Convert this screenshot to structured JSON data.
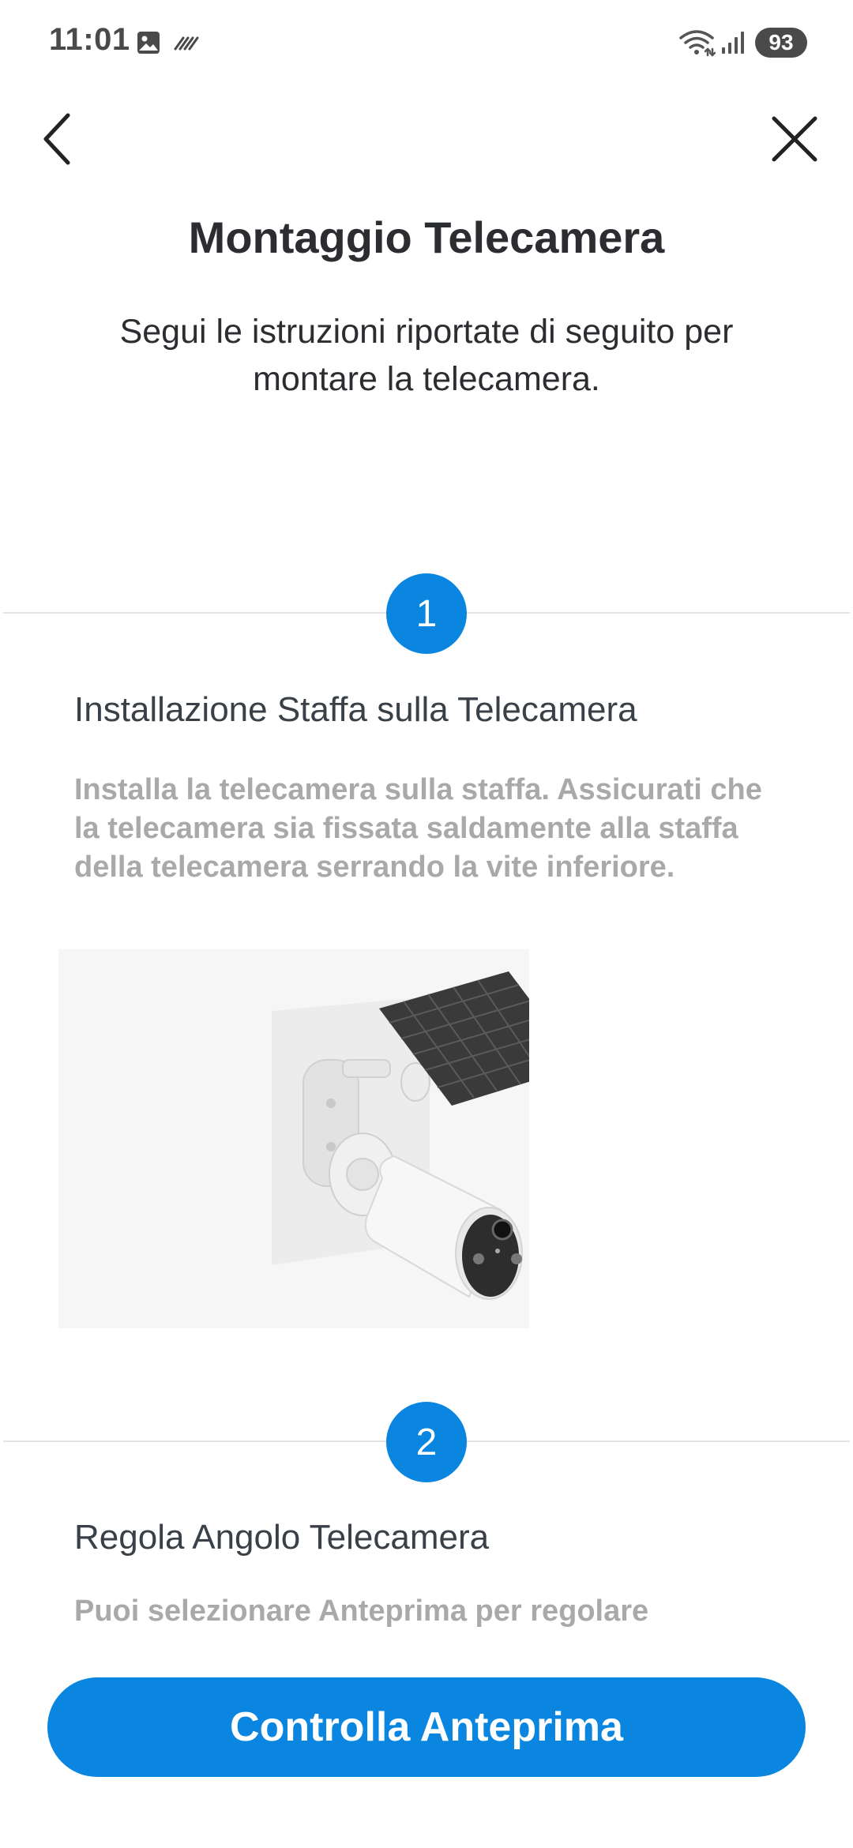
{
  "status_bar": {
    "time": "11:01",
    "battery": "93",
    "icons": [
      "image-icon",
      "nfc-icon",
      "wifi-icon",
      "signal-icon"
    ]
  },
  "nav": {
    "back_icon": "chevron-left-icon",
    "close_icon": "close-icon"
  },
  "header": {
    "title": "Montaggio Telecamera",
    "subtitle": "Segui le istruzioni riportate di seguito per montare la telecamera."
  },
  "steps": [
    {
      "number": "1",
      "title": "Installazione Staffa sulla Telecamera",
      "description": "Installa la telecamera sulla staffa. Assicurati che la telecamera sia fissata saldamente alla staffa della telecamera serrando la vite inferiore.",
      "illustration": "camera-bracket-solar-panel-illustration"
    },
    {
      "number": "2",
      "title": "Regola Angolo Telecamera",
      "description": "Puoi selezionare Anteprima per regolare"
    }
  ],
  "footer": {
    "button_label": "Controlla Anteprima"
  },
  "colors": {
    "accent": "#0a86e0",
    "title_text": "#2b2d31",
    "description_text": "#a9a9a9",
    "divider": "#e4e4e4"
  }
}
